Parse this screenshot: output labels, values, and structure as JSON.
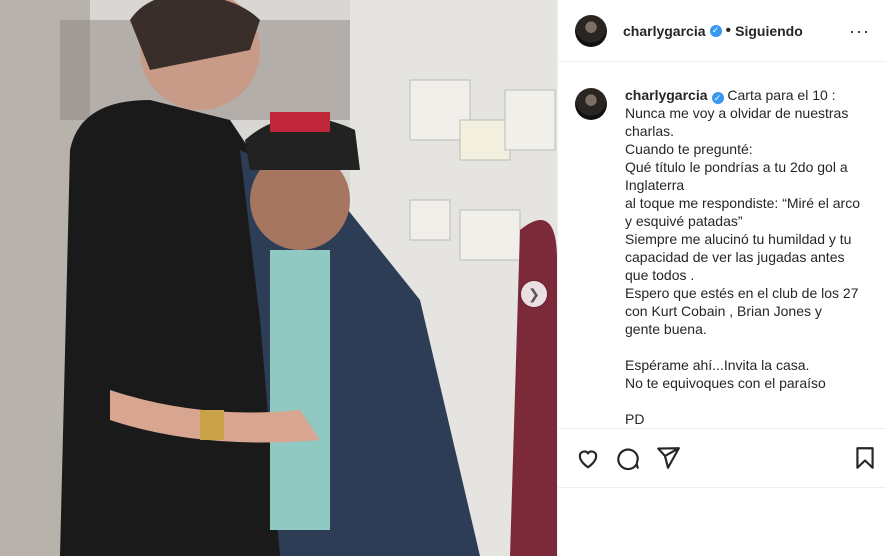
{
  "header": {
    "username": "charlygarcia",
    "verified_icon": "verified-badge-icon",
    "separator": "•",
    "follow_status": "Siguiendo",
    "more_icon": "more-options-icon"
  },
  "caption": {
    "username": "charlygarcia",
    "text": "Carta para el 10 :\nNunca me voy a olvidar de nuestras charlas.\nCuando te pregunté:\nQué título le pondrías a tu 2do gol a Inglaterra\nal toque me respondiste: “Miré el arco y esquivé patadas”\nSiempre me alucinó tu humildad y tu capacidad de ver las jugadas antes que todos .\nEspero que estés en el club de los 27 con Kurt Cobain , Brian Jones y gente buena.\n\nEspérame ahí...Invita la casa.\nNo te equivoques con el paraíso\n\nPD"
  },
  "actions": {
    "like_icon": "heart-icon",
    "comment_icon": "comment-icon",
    "share_icon": "share-icon",
    "save_icon": "bookmark-icon"
  },
  "media": {
    "next_icon": "chevron-right-icon",
    "photo_description_icon": "photo"
  },
  "colors": {
    "verified": "#3897f0",
    "border": "#efefef",
    "text": "#262626"
  }
}
